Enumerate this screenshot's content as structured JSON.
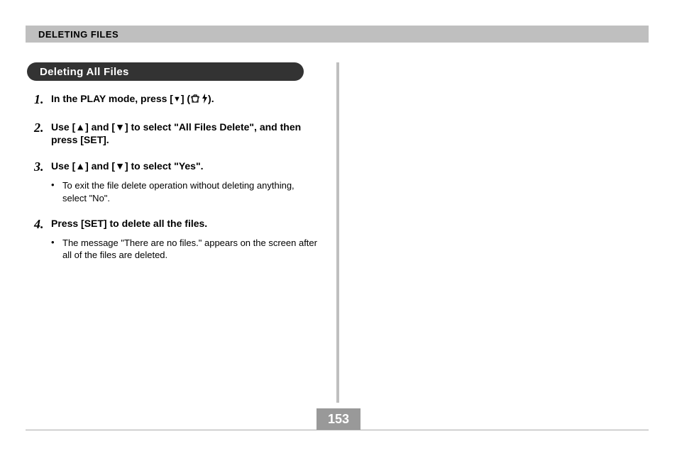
{
  "header": {
    "title": "DELETING FILES"
  },
  "section": {
    "heading": "Deleting All Files"
  },
  "steps": [
    {
      "num": "1.",
      "text_before": "In the PLAY mode, press [",
      "arrow_down": "▼",
      "text_mid": "] (",
      "text_after": ").",
      "bullets": []
    },
    {
      "num": "2.",
      "text": "Use [▲] and [▼] to select \"All Files Delete\", and then press [SET].",
      "bullets": []
    },
    {
      "num": "3.",
      "text": "Use [▲] and [▼] to select \"Yes\".",
      "bullets": [
        "To exit the file delete operation without deleting anything, select \"No\"."
      ]
    },
    {
      "num": "4.",
      "text": "Press [SET] to delete all the files.",
      "bullets": [
        "The message \"There are no files.\" appears on the screen after all of the files are deleted."
      ]
    }
  ],
  "page_number": "153",
  "icons": {
    "trash": "trash-icon",
    "bolt": "bolt-icon"
  }
}
